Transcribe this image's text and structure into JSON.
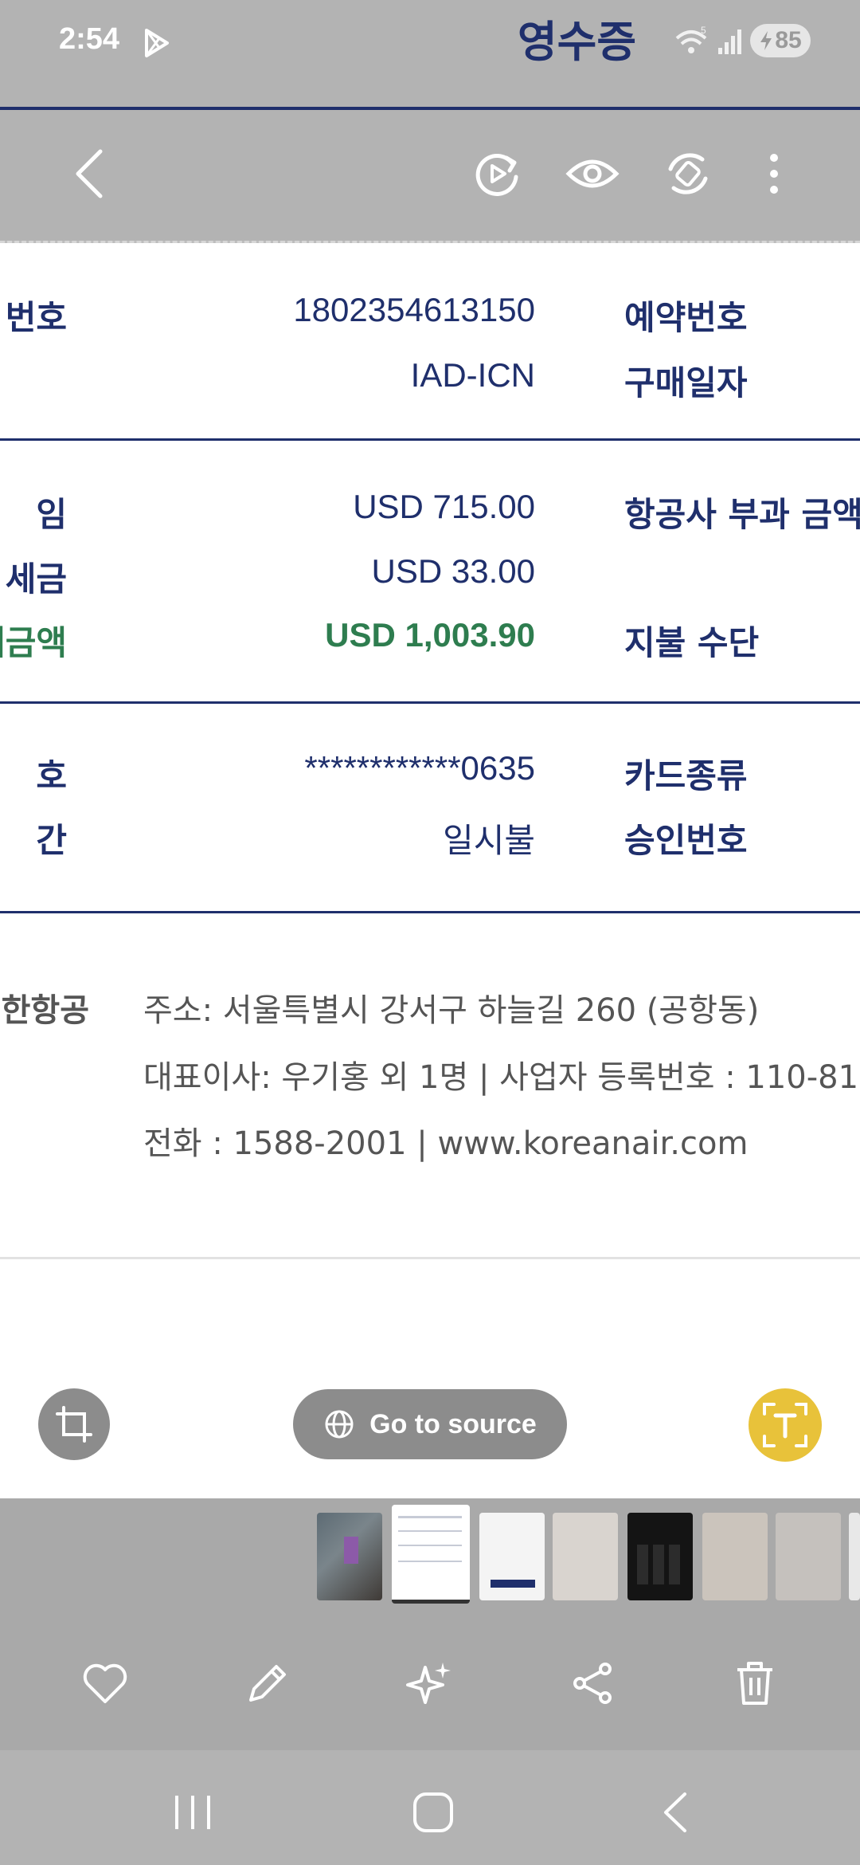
{
  "status_bar": {
    "time": "2:54",
    "battery": "85",
    "icons": [
      "play-store-icon",
      "wifi-icon",
      "signal-icon",
      "battery-charging-icon"
    ]
  },
  "document_heading": "영수증",
  "toolbar": {
    "icons": [
      "back-arrow-icon",
      "rotate-play-icon",
      "eye-icon",
      "auto-rotate-icon",
      "more-options-icon"
    ]
  },
  "receipt": {
    "section1": [
      {
        "left_label": "번호",
        "value": "1802354613150",
        "right_label": "예약번호"
      },
      {
        "left_label": "",
        "value": "IAD-ICN",
        "right_label": "구매일자"
      }
    ],
    "section2": [
      {
        "left_label": "임",
        "value": "USD 715.00",
        "right_label": "항공사 부과 금액"
      },
      {
        "left_label": "세금",
        "value": "USD 33.00",
        "right_label": ""
      },
      {
        "left_label": "세금액",
        "value": "USD 1,003.90",
        "right_label": "지불 수단"
      }
    ],
    "section3": [
      {
        "left_label": "호",
        "value": "************0635",
        "right_label": "카드종류"
      },
      {
        "left_label": "간",
        "value": "일시불",
        "right_label": "승인번호"
      }
    ],
    "footer": {
      "company": "한항공",
      "address": "주소: 서울특별시 강서구 하늘길 260 (공항동)",
      "ceo_line": "대표이사: 우기홍 외 1명 | 사업자 등록번호 : 110-81",
      "contact_line": "전화 : 1588-2001 | www.koreanair.com"
    }
  },
  "floating": {
    "go_to_source": "Go to source"
  },
  "colors": {
    "navy": "#1f2f6c",
    "green_total": "#2e7d4f",
    "text_extract_yellow": "#e8c23a"
  }
}
